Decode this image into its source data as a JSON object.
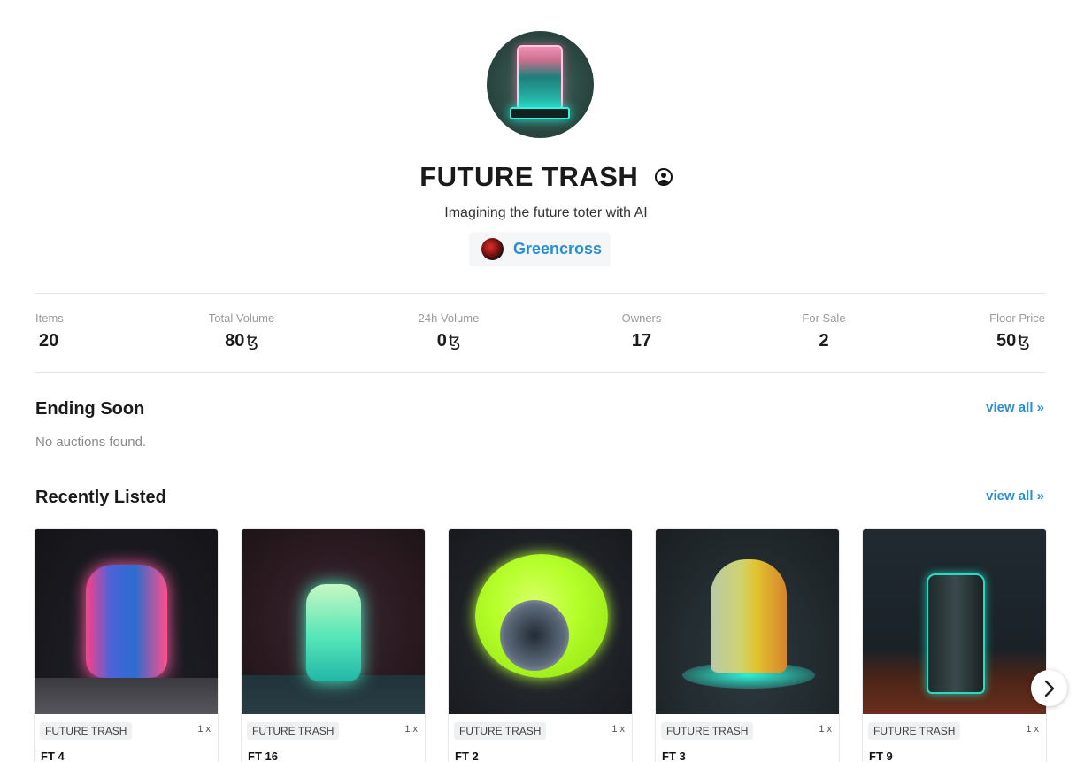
{
  "collection": {
    "title": "FUTURE TRASH",
    "description": "Imagining the future toter with AI",
    "creator": "Greencross"
  },
  "stats": [
    {
      "label": "Items",
      "value": "20",
      "currency": ""
    },
    {
      "label": "Total Volume",
      "value": "80",
      "currency": "ꜩ"
    },
    {
      "label": "24h Volume",
      "value": "0",
      "currency": "ꜩ"
    },
    {
      "label": "Owners",
      "value": "17",
      "currency": ""
    },
    {
      "label": "For Sale",
      "value": "2",
      "currency": ""
    },
    {
      "label": "Floor Price",
      "value": "50",
      "currency": "ꜩ"
    }
  ],
  "ending_soon": {
    "title": "Ending Soon",
    "view_all": "view all »",
    "empty": "No auctions found."
  },
  "recently_listed": {
    "title": "Recently Listed",
    "view_all": "view all »",
    "items": [
      {
        "tag": "FUTURE TRASH",
        "qty": "1 x",
        "name": "FT 4"
      },
      {
        "tag": "FUTURE TRASH",
        "qty": "1 x",
        "name": "FT 16"
      },
      {
        "tag": "FUTURE TRASH",
        "qty": "1 x",
        "name": "FT 2"
      },
      {
        "tag": "FUTURE TRASH",
        "qty": "1 x",
        "name": "FT 3"
      },
      {
        "tag": "FUTURE TRASH",
        "qty": "1 x",
        "name": "FT 9"
      }
    ]
  },
  "icons": {
    "verified": "user-circle-icon",
    "next": "chevron-right-icon"
  },
  "colors": {
    "accent": "#2a8fd0"
  }
}
